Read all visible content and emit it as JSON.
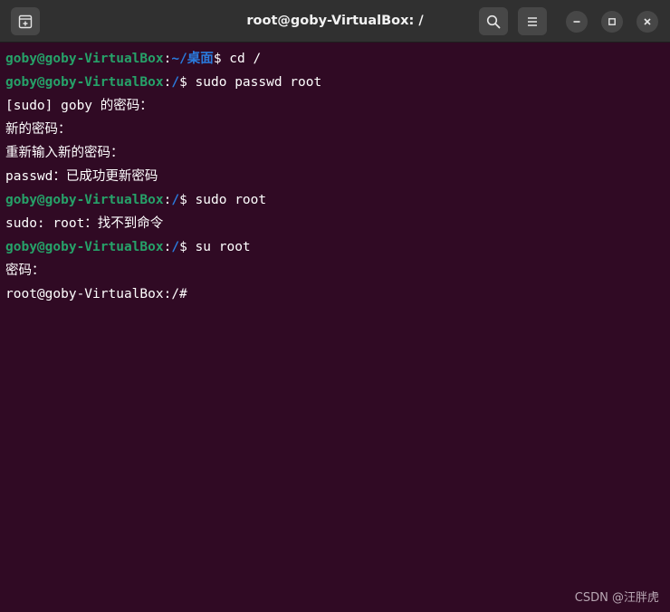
{
  "window": {
    "title": "root@goby-VirtualBox: /"
  },
  "titlebar": {
    "new_tab_icon": "new-tab-icon",
    "search_icon": "search-icon",
    "menu_icon": "hamburger-menu-icon",
    "minimize_icon": "minimize-icon",
    "maximize_icon": "maximize-icon",
    "close_icon": "close-icon"
  },
  "colors": {
    "background": "#300a24",
    "prompt_user": "#26a269",
    "prompt_path": "#2a7bde",
    "text": "#ffffff"
  },
  "terminal": {
    "lines": [
      {
        "type": "prompt",
        "user": "goby@goby-VirtualBox",
        "path": "~/桌面",
        "command": " cd /"
      },
      {
        "type": "prompt",
        "user": "goby@goby-VirtualBox",
        "path": "/",
        "command": " sudo passwd root"
      },
      {
        "type": "output",
        "text": "[sudo] goby 的密码："
      },
      {
        "type": "output",
        "text": "新的密码："
      },
      {
        "type": "output",
        "text": "重新输入新的密码："
      },
      {
        "type": "output",
        "text": "passwd：已成功更新密码"
      },
      {
        "type": "prompt",
        "user": "goby@goby-VirtualBox",
        "path": "/",
        "command": " sudo root"
      },
      {
        "type": "output",
        "text": "sudo: root：找不到命令"
      },
      {
        "type": "prompt",
        "user": "goby@goby-VirtualBox",
        "path": "/",
        "command": " su root"
      },
      {
        "type": "output",
        "text": "密码："
      },
      {
        "type": "output",
        "text": "root@goby-VirtualBox:/#"
      }
    ]
  },
  "prompt_symbols": {
    "colon": ":",
    "dollar": "$"
  },
  "watermark": {
    "text": "CSDN @汪胖虎"
  }
}
